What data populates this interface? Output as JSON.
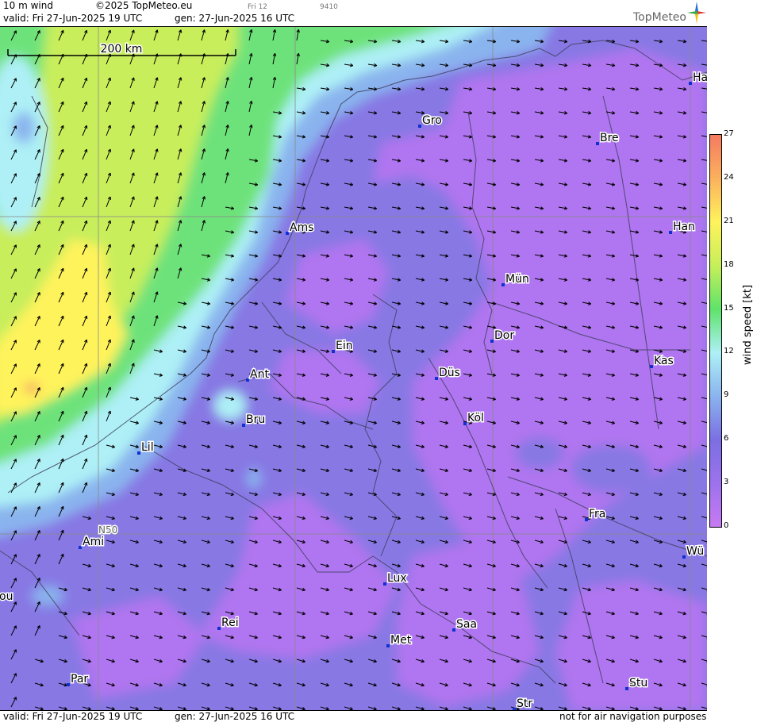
{
  "header": {
    "product": "10 m wind",
    "copyright": "©2025 TopMeteo.eu",
    "valid": "valid:  Fri  27-Jun-2025  19 UTC",
    "generated": "gen: 27-Jun-2025 16 UTC",
    "small_label_1": "Fri 12",
    "small_label_2": "9410",
    "brand": "TopMeteo"
  },
  "footer": {
    "valid": "valid:  Fri  27-Jun-2025  19 UTC",
    "generated": "gen: 27-Jun-2025 16 UTC",
    "disclaimer": "not for air navigation purposes"
  },
  "map": {
    "scale_label": "200 km",
    "lat_label": "N50",
    "cities": [
      {
        "name": "Ha"
      },
      {
        "name": "Gro"
      },
      {
        "name": "Bre"
      },
      {
        "name": "Ams"
      },
      {
        "name": "Han"
      },
      {
        "name": "Mün"
      },
      {
        "name": "Dor"
      },
      {
        "name": "Ein"
      },
      {
        "name": "Kas"
      },
      {
        "name": "Ant"
      },
      {
        "name": "Düs"
      },
      {
        "name": "Bru"
      },
      {
        "name": "Köl"
      },
      {
        "name": "Lil"
      },
      {
        "name": "Fra"
      },
      {
        "name": "Ami"
      },
      {
        "name": "Wü"
      },
      {
        "name": "ou"
      },
      {
        "name": "Lux"
      },
      {
        "name": "Rei"
      },
      {
        "name": "Saa"
      },
      {
        "name": "Met"
      },
      {
        "name": "Par"
      },
      {
        "name": "Stu"
      },
      {
        "name": "Str"
      }
    ]
  },
  "legend": {
    "unit": "wind speed  [kt]",
    "ticks": [
      "0",
      "3",
      "6",
      "9",
      "12",
      "15",
      "18",
      "21",
      "24",
      "27"
    ],
    "colors": [
      "#c77af2",
      "#9d72ec",
      "#7b6fe2",
      "#8ab4ee",
      "#aef0f6",
      "#5fe36a",
      "#c6ef5a",
      "#fff35c",
      "#fbb15e",
      "#f57a62"
    ]
  },
  "colors": {
    "calm": "#9a6ee8",
    "light": "#8a7ae6",
    "sea_moderate": "#aef0f6",
    "sea_fresh": "#6ee27a",
    "sea_strong": "#c8ee5c",
    "gust": "#fff35c"
  }
}
